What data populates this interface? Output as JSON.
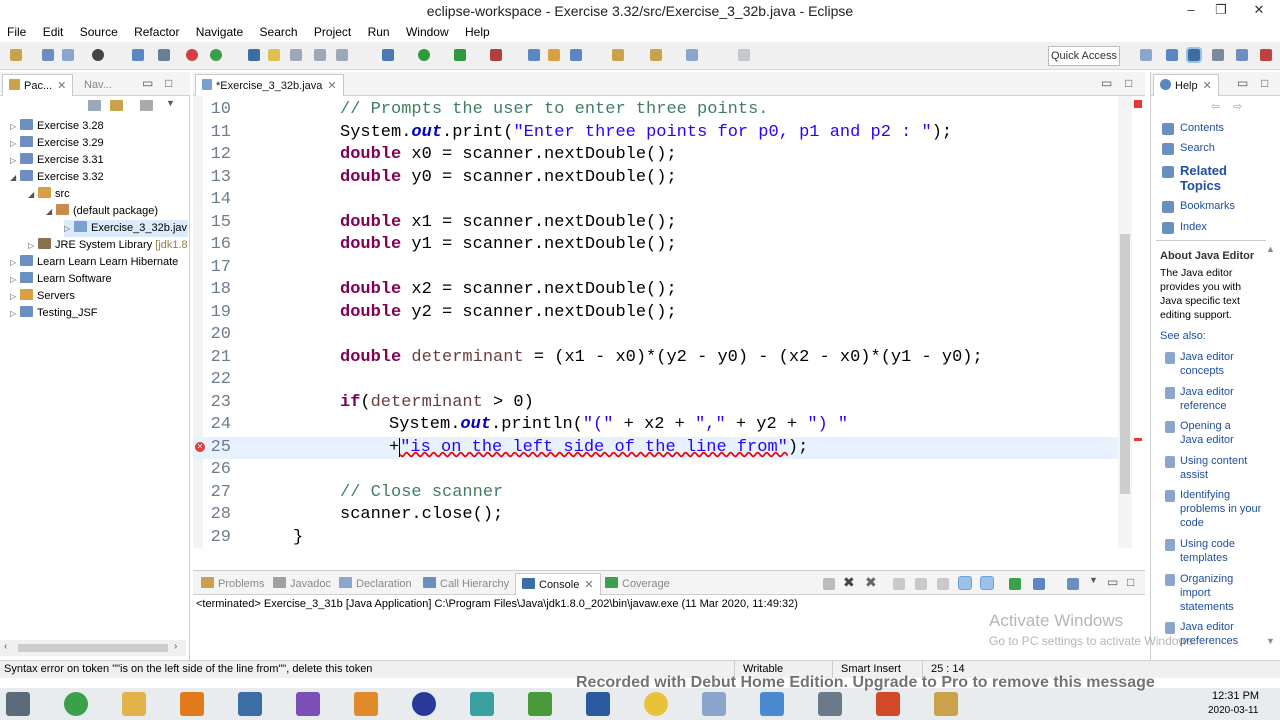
{
  "window": {
    "title": "eclipse-workspace - Exercise 3.32/src/Exercise_3_32b.java - Eclipse",
    "min": "–",
    "max": "❐",
    "close": "✕"
  },
  "menu": [
    "File",
    "Edit",
    "Source",
    "Refactor",
    "Navigate",
    "Search",
    "Project",
    "Run",
    "Window",
    "Help"
  ],
  "toolbar": {
    "quick_access": "Quick Access"
  },
  "left_panel": {
    "tabs": [
      {
        "label": "Pac..."
      },
      {
        "label": "Nav..."
      }
    ],
    "tree": [
      {
        "label": "Exercise 3.28"
      },
      {
        "label": "Exercise 3.29"
      },
      {
        "label": "Exercise 3.31"
      },
      {
        "label": "Exercise 3.32"
      },
      {
        "label": "src"
      },
      {
        "label": "(default package)"
      },
      {
        "label": "Exercise_3_32b.jav"
      },
      {
        "label": "JRE System Library",
        "suffix": "[jdk1.8"
      },
      {
        "label": "Learn Learn Learn Hibernate"
      },
      {
        "label": "Learn Software"
      },
      {
        "label": "Servers"
      },
      {
        "label": "Testing_JSF"
      }
    ]
  },
  "editor": {
    "tab": "*Exercise_3_32b.java",
    "lines": [
      {
        "n": "10"
      },
      {
        "n": "11"
      },
      {
        "n": "12"
      },
      {
        "n": "13"
      },
      {
        "n": "14"
      },
      {
        "n": "15"
      },
      {
        "n": "16"
      },
      {
        "n": "17"
      },
      {
        "n": "18"
      },
      {
        "n": "19"
      },
      {
        "n": "20"
      },
      {
        "n": "21"
      },
      {
        "n": "22"
      },
      {
        "n": "23"
      },
      {
        "n": "24"
      },
      {
        "n": "25"
      },
      {
        "n": "26"
      },
      {
        "n": "27"
      },
      {
        "n": "28"
      },
      {
        "n": "29"
      }
    ],
    "code": {
      "l10": "// Prompts the user to enter three points.",
      "l11a": "System.",
      "l11b": "out",
      "l11c": ".print(",
      "l11d": "\"Enter three points for p0, p1 and p2 : \"",
      "l11e": ");",
      "double": "double",
      "l12": " x0 = scanner.nextDouble();",
      "l13": " y0 = scanner.nextDouble();",
      "l15": " x1 = scanner.nextDouble();",
      "l16": " y1 = scanner.nextDouble();",
      "l18": " x2 = scanner.nextDouble();",
      "l19": " y2 = scanner.nextDouble();",
      "l21a": "determinant",
      "l21b": " = (x1 - x0)*(y2 - y0) - (x2 - x0)*(y1 - y0);",
      "l23a": "if",
      "l23b": "(",
      "l23c": "determinant",
      "l23d": " > 0)",
      "l24a": "System.",
      "l24b": "out",
      "l24c": ".println(",
      "l24d": "\"(\"",
      "l24e": " + x2 + ",
      "l24f": "\",\"",
      "l24g": " + y2 + ",
      "l24h": "\") \"",
      "l25a": "+",
      "l25b": "\"is on the left side of the line from\"",
      "l25c": ");",
      "l27": "// Close scanner",
      "l28": "scanner.close();",
      "l29": "}"
    }
  },
  "bottom_panel": {
    "tabs": [
      "Problems",
      "Javadoc",
      "Declaration",
      "Call Hierarchy",
      "Console",
      "Coverage"
    ],
    "active_tab": "Console",
    "console_text": "<terminated> Exercise_3_31b [Java Application] C:\\Program Files\\Java\\jdk1.8.0_202\\bin\\javaw.exe (11 Mar 2020, 11:49:32)"
  },
  "help_panel": {
    "tab": "Help",
    "nav": [
      "Contents",
      "Search",
      "Related Topics",
      "Bookmarks",
      "Index"
    ],
    "about_title": "About Java Editor",
    "about_text": "The Java editor provides you with Java specific text editing support.",
    "see_also": "See also:",
    "links": [
      "Java editor concepts",
      "Java editor reference",
      "Opening a Java editor",
      "Using content assist",
      "Identifying problems in your code",
      "Using code templates",
      "Organizing import statements",
      "Java editor preferences"
    ]
  },
  "watermark": {
    "line1": "Activate Windows",
    "line2": "Go to PC settings to activate Windows."
  },
  "statusbar": {
    "message": "Syntax error on token \"\"is on the left side of the line from\"\", delete this token",
    "writable": "Writable",
    "insert": "Smart Insert",
    "position": "25 : 14"
  },
  "recording_banner": "Recorded with Debut Home Edition. Upgrade to Pro to remove this message",
  "clock": {
    "time": "12:31 PM",
    "date": "2020-03-11"
  }
}
